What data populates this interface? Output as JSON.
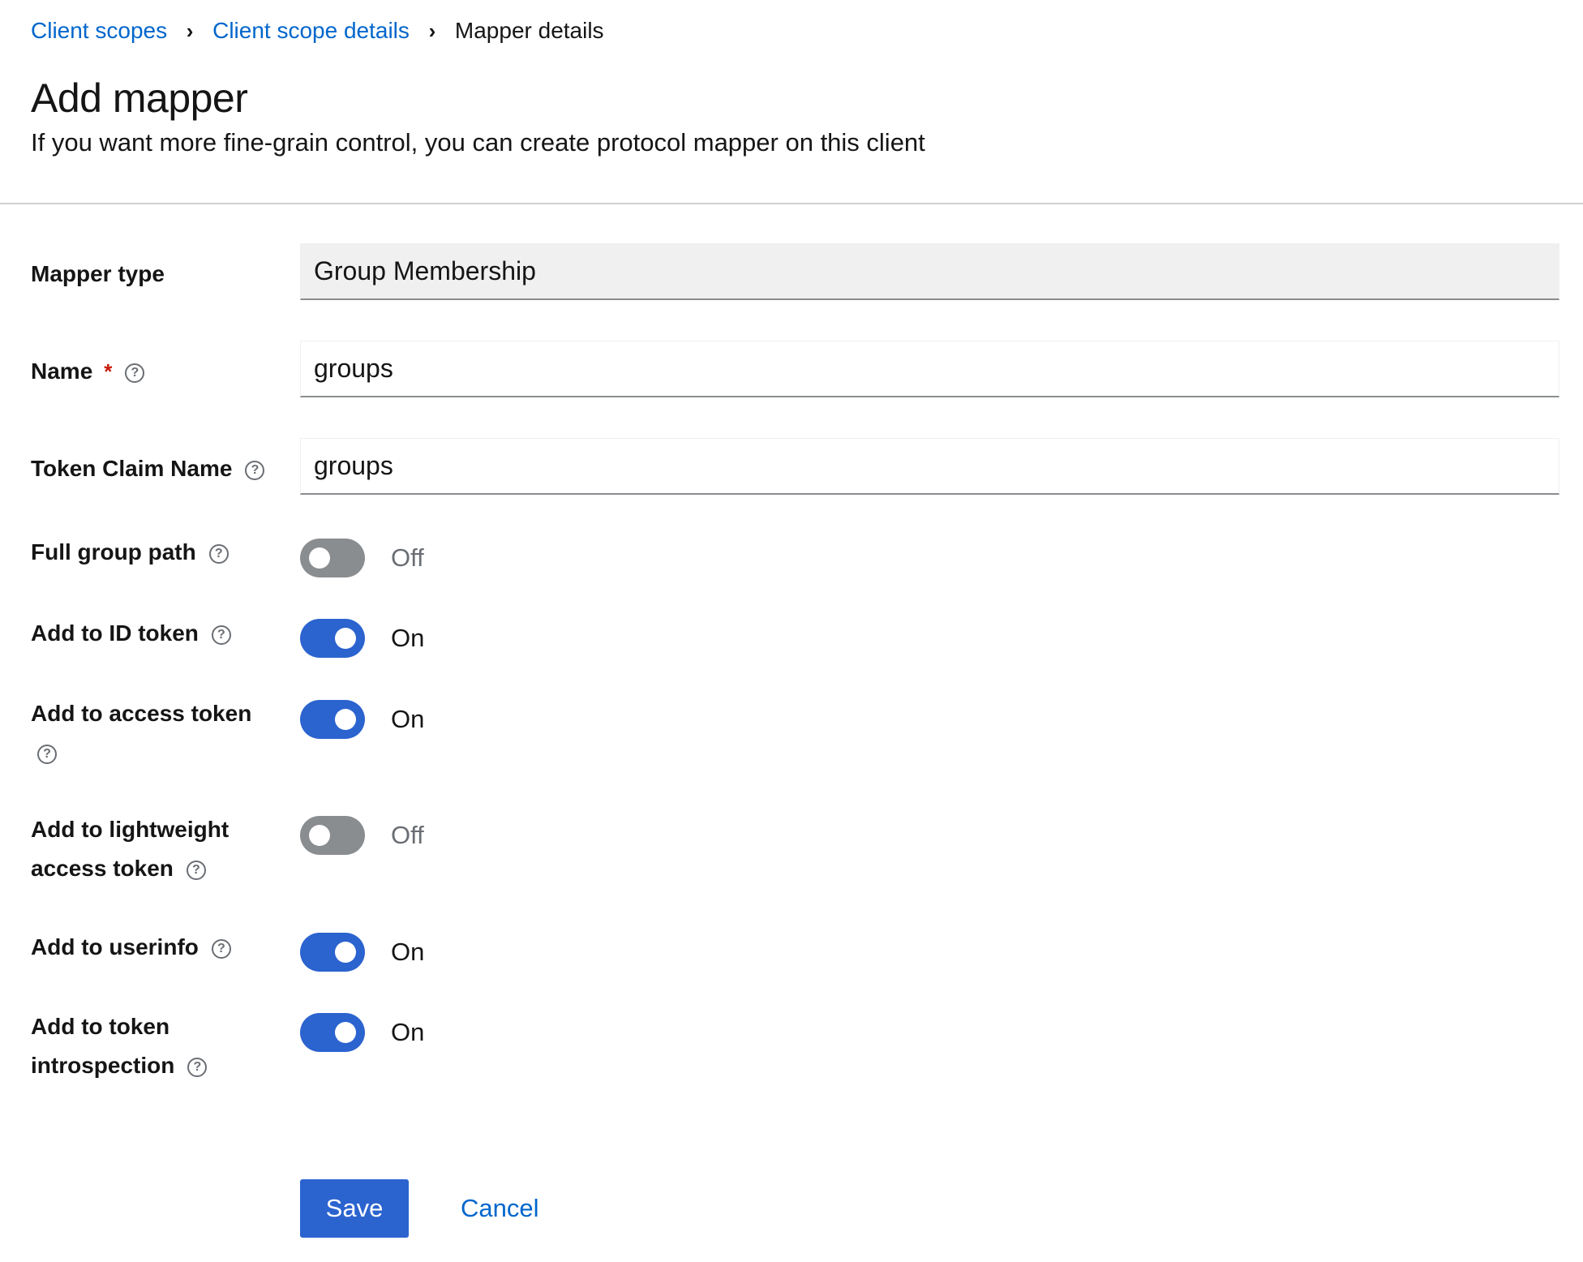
{
  "breadcrumb": {
    "items": [
      "Client scopes",
      "Client scope details"
    ],
    "current": "Mapper details"
  },
  "header": {
    "title": "Add mapper",
    "subtitle": "If you want more fine-grain control, you can create protocol mapper on this client"
  },
  "form": {
    "mapper_type": {
      "label": "Mapper type",
      "value": "Group Membership"
    },
    "name": {
      "label": "Name",
      "required_marker": "*",
      "value": "groups"
    },
    "token_claim_name": {
      "label": "Token Claim Name",
      "value": "groups"
    },
    "toggles": [
      {
        "label": "Full group path",
        "state": "Off"
      },
      {
        "label": "Add to ID token",
        "state": "On"
      },
      {
        "label": "Add to access token",
        "state": "On"
      },
      {
        "label": "Add to lightweight access token",
        "state": "Off"
      },
      {
        "label": "Add to userinfo",
        "state": "On"
      },
      {
        "label": "Add to token introspection",
        "state": "On"
      }
    ]
  },
  "actions": {
    "save_label": "Save",
    "cancel_label": "Cancel"
  },
  "colors": {
    "primary": "#2b63cf",
    "link": "#0066cc",
    "switch_off": "#8a8d90",
    "required": "#c9190b"
  }
}
